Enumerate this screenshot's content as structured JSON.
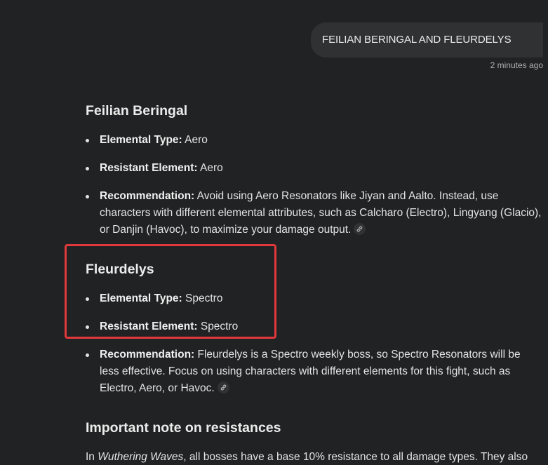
{
  "user_message": {
    "text": "FEILIAN BERINGAL AND FLEURDELYS",
    "timestamp": "2 minutes ago"
  },
  "sections": [
    {
      "heading": "Feilian Beringal",
      "items": [
        {
          "label": "Elemental Type:",
          "text": " Aero"
        },
        {
          "label": "Resistant Element:",
          "text": " Aero"
        },
        {
          "label": "Recommendation:",
          "text": " Avoid using Aero Resonators like Jiyan and Aalto. Instead, use characters with different elemental attributes, such as Calcharo (Electro), Lingyang (Glacio), or Danjin (Havoc), to maximize your damage output."
        }
      ]
    },
    {
      "heading": "Fleurdelys",
      "items": [
        {
          "label": "Elemental Type:",
          "text": " Spectro"
        },
        {
          "label": "Resistant Element:",
          "text": " Spectro"
        },
        {
          "label": "Recommendation:",
          "text": " Fleurdelys is a Spectro weekly boss, so Spectro Resonators will be less effective. Focus on using characters with different elements for this fight, such as Electro, Aero, or Havoc."
        }
      ]
    },
    {
      "heading": "Important note on resistances"
    }
  ],
  "note": {
    "prefix": "In ",
    "game": "Wuthering Waves",
    "suffix": ", all bosses have a base 10% resistance to all damage types. They also"
  },
  "icons": {
    "source_link": "link-icon"
  },
  "colors": {
    "background": "#212223",
    "user_bubble": "#2f3133",
    "highlight_border": "#e0383b"
  }
}
